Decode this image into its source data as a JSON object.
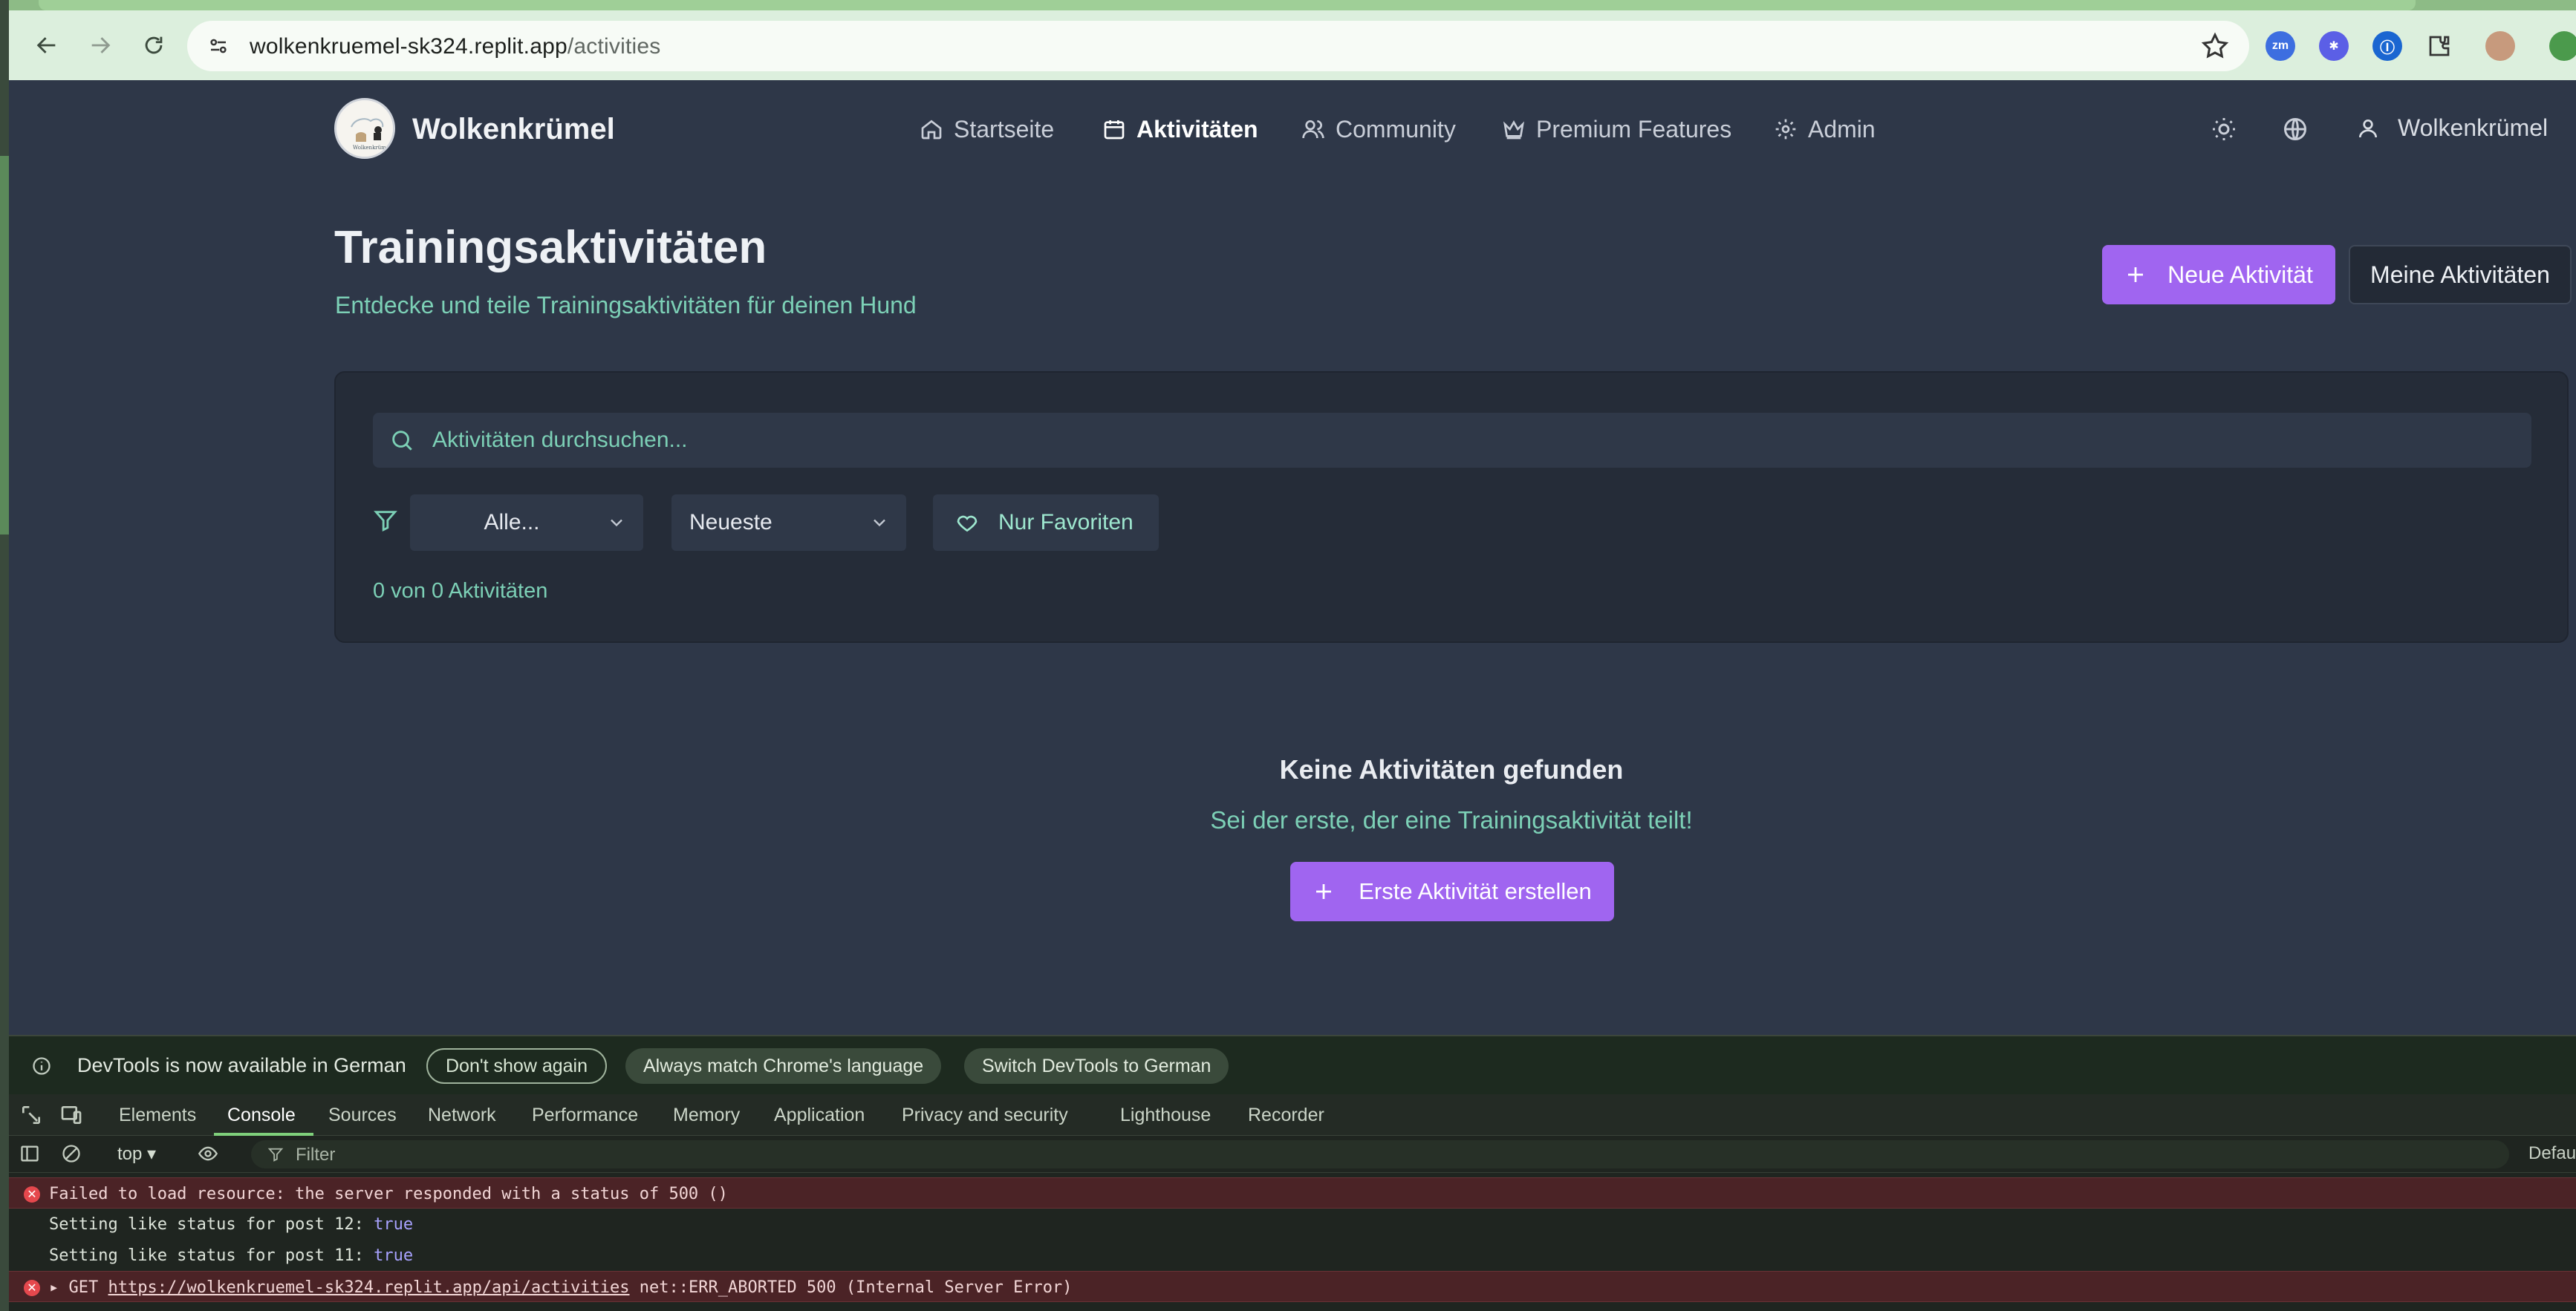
{
  "browser": {
    "url_host": "wolkenkruemel-sk324.replit.app",
    "url_path": "/activities"
  },
  "header": {
    "brand": "Wolkenkrümel",
    "nav": [
      {
        "label": "Startseite",
        "icon": "home-icon"
      },
      {
        "label": "Aktivitäten",
        "icon": "calendar-icon",
        "active": true
      },
      {
        "label": "Community",
        "icon": "users-icon"
      },
      {
        "label": "Premium Features",
        "icon": "crown-icon"
      },
      {
        "label": "Admin",
        "icon": "gear-icon"
      }
    ],
    "user": "Wolkenkrümel"
  },
  "page": {
    "title": "Trainingsaktivitäten",
    "subtitle": "Entdecke und teile Trainingsaktivitäten für deinen Hund",
    "new_activity": "Neue Aktivität",
    "my_activities": "Meine Aktivitäten"
  },
  "filters": {
    "search_placeholder": "Aktivitäten durchsuchen...",
    "category_value": "Alle...",
    "sort_value": "Neueste",
    "favorites_label": "Nur Favoriten",
    "count_text": "0 von 0 Aktivitäten"
  },
  "empty": {
    "title": "Keine Aktivitäten gefunden",
    "subtitle": "Sei der erste, der eine Trainingsaktivität teilt!",
    "button": "Erste Aktivität erstellen"
  },
  "devtools": {
    "info_message": "DevTools is now available in German",
    "dont_show": "Don't show again",
    "always_match": "Always match Chrome's language",
    "switch_german": "Switch DevTools to German",
    "tabs": [
      "Elements",
      "Console",
      "Sources",
      "Network",
      "Performance",
      "Memory",
      "Application",
      "Privacy and security",
      "Lighthouse",
      "Recorder"
    ],
    "active_tab": "Console",
    "context": "top",
    "filter_placeholder": "Filter",
    "default_levels": "Defau",
    "logs": {
      "error1": "Failed to load resource: the server responded with a status of 500 ()",
      "log2_text": "Setting like status for post 12: ",
      "log2_value": "true",
      "log3_text": "Setting like status for post 11: ",
      "log3_value": "true",
      "error4_method": "GET",
      "error4_url": "https://wolkenkruemel-sk324.replit.app/api/activities",
      "error4_status": "net::ERR_ABORTED 500 (Internal Server Error)"
    }
  },
  "colors": {
    "accent": "#a065f0",
    "teal_text": "#7cd0b6",
    "page_bg": "#2e3748"
  }
}
